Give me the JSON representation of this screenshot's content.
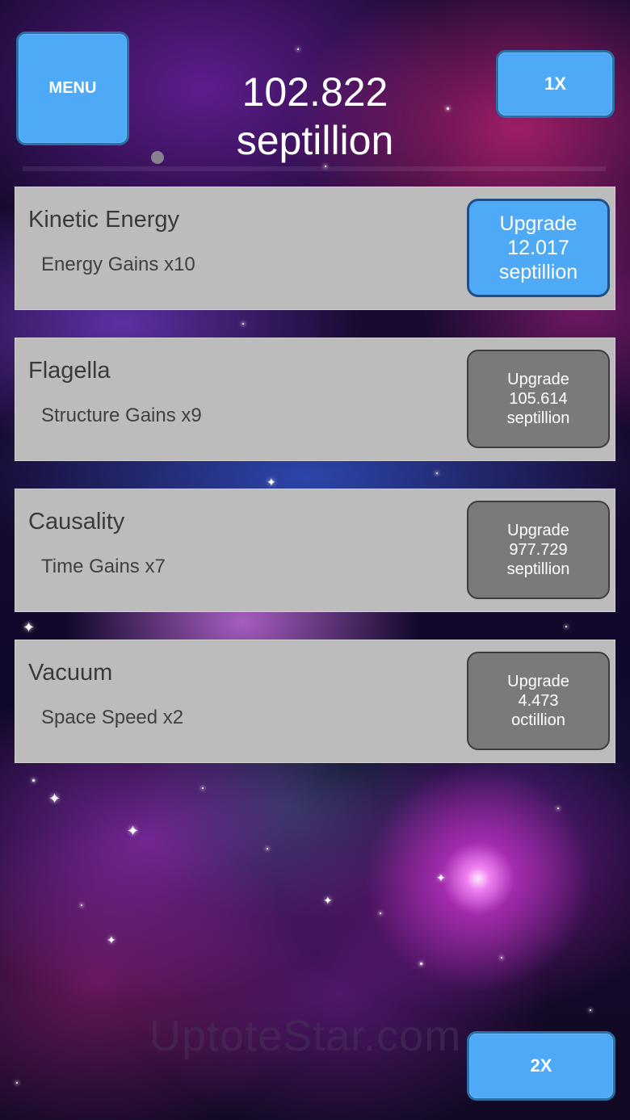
{
  "header": {
    "menu_label": "MENU",
    "currency_amount": "102.822",
    "currency_unit": "septillion",
    "speed_label": "1X"
  },
  "progress": {
    "fraction": 0.22
  },
  "upgrades": [
    {
      "title": "Kinetic Energy",
      "desc": "Energy Gains x10",
      "button_label": "Upgrade",
      "cost_value": "12.017",
      "cost_unit": "septillion",
      "affordable": true
    },
    {
      "title": "Flagella",
      "desc": "Structure Gains x9",
      "button_label": "Upgrade",
      "cost_value": "105.614",
      "cost_unit": "septillion",
      "affordable": false
    },
    {
      "title": "Causality",
      "desc": "Time Gains x7",
      "button_label": "Upgrade",
      "cost_value": "977.729",
      "cost_unit": "septillion",
      "affordable": false
    },
    {
      "title": "Vacuum",
      "desc": "Space Speed x2",
      "button_label": "Upgrade",
      "cost_value": "4.473",
      "cost_unit": "octillion",
      "affordable": false
    }
  ],
  "footer": {
    "speed_label": "2X"
  },
  "watermark": "UptoteStar.com",
  "colors": {
    "button_blue": "#4eaaf6",
    "button_disabled": "#7a7a7a",
    "panel_gray": "#bcbcbc"
  }
}
